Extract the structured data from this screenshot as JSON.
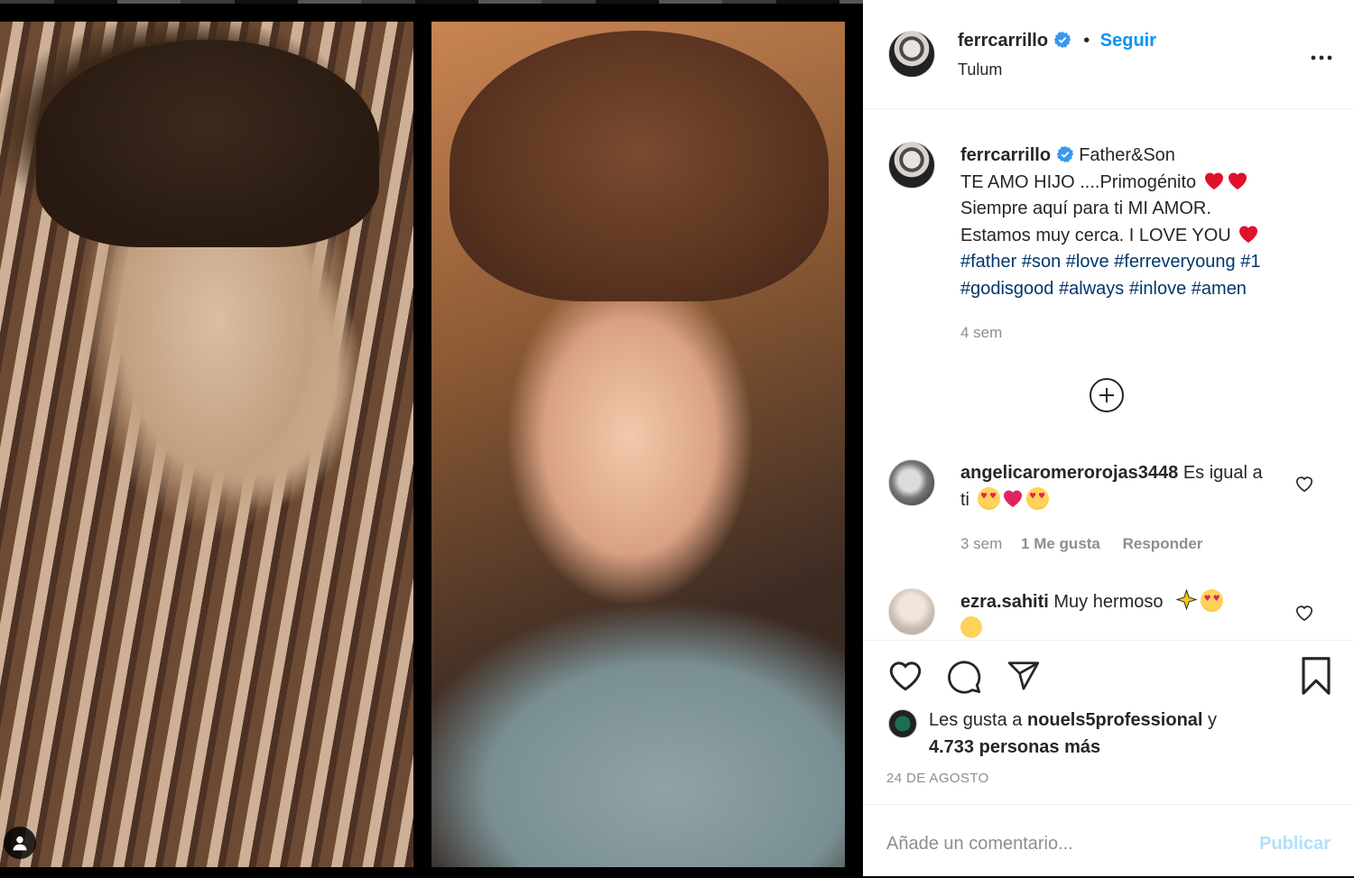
{
  "post": {
    "username": "ferrcarrillo",
    "follow_label": "Seguir",
    "location": "Tulum",
    "more_label": "...",
    "caption": {
      "title": "Father&Son",
      "line1": "TE AMO HIJO ....Primogénito",
      "line2": "Siempre aquí para ti MI AMOR.",
      "line3": "Estamos muy cerca. I LOVE YOU",
      "hashtags_line1": [
        "#father",
        "#son",
        "#love",
        "#ferreveryoung",
        "#1"
      ],
      "hashtags_line2": [
        "#godisgood",
        "#always",
        "#inlove",
        "#amen"
      ],
      "age": "4 sem"
    }
  },
  "comments": [
    {
      "username": "angelicaromerorojas3448",
      "text": "Es igual a ti",
      "age": "3 sem",
      "likes": "1 Me gusta",
      "reply_label": "Responder"
    },
    {
      "username": "ezra.sahiti",
      "text": "Muy hermoso"
    }
  ],
  "footer": {
    "likes_prefix": "Les gusta a",
    "liked_by_user": "nouels5professional",
    "likes_joiner": "y",
    "likes_rest": "4.733 personas más",
    "date": "24 DE AGOSTO",
    "comment_placeholder": "Añade un comentario...",
    "publish_label": "Publicar"
  },
  "colors": {
    "accent": "#0095f6",
    "hashtag": "#00376b",
    "muted": "#8e8e8e",
    "verified": "#3897f0",
    "publish_disabled": "#b2dffc"
  },
  "icons": [
    "verified-badge-icon",
    "more-options-icon",
    "add-circle-icon",
    "heart-outline-icon",
    "comment-icon",
    "share-icon",
    "bookmark-icon",
    "user-tag-icon"
  ]
}
